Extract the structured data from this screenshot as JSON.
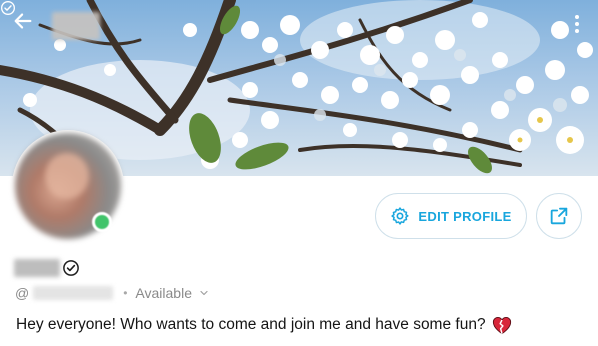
{
  "profile": {
    "handle_prefix": "@",
    "status": "Available",
    "bio": "Hey everyone! Who wants to come and join me and have some fun?"
  },
  "actions": {
    "edit_label": "EDIT PROFILE"
  },
  "icons": {
    "back": "arrow-left-icon",
    "verified": "verified-check-icon",
    "more": "more-vertical-icon",
    "settings": "gear-icon",
    "share": "share-icon",
    "status_toggle": "chevron-down-icon",
    "bio_emoji": "broken-heart-icon"
  },
  "colors": {
    "accent": "#18a6dd",
    "online": "#41c46b",
    "secondary_text": "#8a8a8a"
  }
}
